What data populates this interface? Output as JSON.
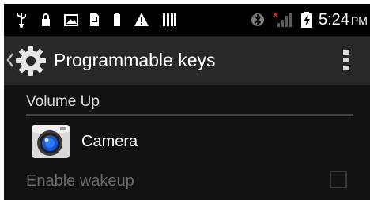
{
  "status_bar": {
    "time": "5:24",
    "ampm": "PM",
    "icons": [
      "usb-icon",
      "lock-icon",
      "image-icon",
      "sd-card-icon",
      "battery-small-icon",
      "warning-icon",
      "barcode-icon",
      "bluetooth-icon",
      "no-signal-icon",
      "battery-charging-icon"
    ]
  },
  "action_bar": {
    "title": "Programmable keys",
    "icon": "gear-icon"
  },
  "content": {
    "section_header": "Volume Up",
    "item": {
      "icon": "camera-icon",
      "label": "Camera"
    },
    "pref": {
      "label": "Enable wakeup",
      "checked": false
    }
  }
}
